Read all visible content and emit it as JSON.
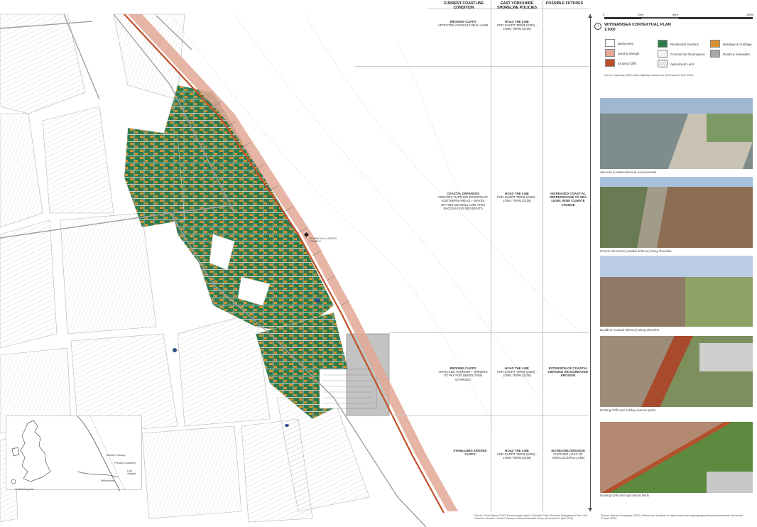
{
  "columns": {
    "current": "CURRENT COASTLINE CONDITION",
    "policies": "EAST YORKSHIRE SHORELINE POLICIES",
    "futures": "POSSIBLE FUTURES"
  },
  "rows": [
    {
      "condition_title": "ERODING CLIFFS",
      "condition_text": "AFFECTED AGRICULTURAL LAND",
      "policy_title": "HOLD THE LINE",
      "policy_text": "FOR SHORT TERM (2025) - LONG TERM (2105)",
      "future_title": "",
      "future_text": ""
    },
    {
      "condition_title": "COASTAL DEFENCES",
      "condition_text": "CREATES FURTHER EROSION AT SOUTHERN AREAS + WAVES HITTING SEAWALL CRE-ATES SHOCKS FOR RESIDENTS",
      "policy_title": "HOLD THE LINE",
      "policy_text": "FOR SHORT TERM (2025) - LONG TERM (2105)",
      "future_title": "INCREASED COAST-AL DEFENCES DUE TO SEA LEVEL RISE/ CLIMATE CHANGE",
      "future_text": ""
    },
    {
      "condition_title": "ERODING CLIFFS",
      "condition_text": "AFFECTED TOURISM + OWNERS TO PAY FOR DEMOLITION CHARGES",
      "policy_title": "HOLD THE LINE",
      "policy_text": "FOR SHORT TERM (2025) - LONG TERM (2105)",
      "future_title": "EXTENSION OF COASTAL DEFENCE OR INCREASED EROSION",
      "future_text": ""
    },
    {
      "condition_title": "STABILIZING ERODED CLIFFS",
      "condition_text": "",
      "policy_title": "HOLD THE LINE",
      "policy_text": "FOR SHORT TERM (2025) - LONG TERM (2105)",
      "future_title": "INCREASED EROSION",
      "future_text": "FURTHER LOSS OF AGRICULTURAL LAND"
    }
  ],
  "map_label": "KILNWICK ALL SAINTS CHURCH",
  "plan": {
    "title": "WITHERNSEA CONTEXTUAL PLAN",
    "scale": "1:5000",
    "scalebar": [
      "0",
      "25m",
      "50m",
      "100m"
    ],
    "legend": [
      {
        "label": "Bathymetry",
        "color": "#ffffff"
      },
      {
        "label": "Sand & Shingle",
        "color": "#e3a897"
      },
      {
        "label": "Eroding Cliffs",
        "color": "#c0502a"
      },
      {
        "label": "Residential Gardens",
        "color": "#2f7a4a"
      },
      {
        "label": "Commercial Greenspace",
        "color": "#f4f4f4"
      },
      {
        "label": "Agricultural Land",
        "color": "#f7f7f4"
      },
      {
        "label": "Buildings & Curtilage",
        "color": "#d9902f"
      },
      {
        "label": "Roads & Sidewalks",
        "color": "#a8a8a8"
      }
    ],
    "source": "Source: Digimaps (2020) https://digimap.edina.ac.uk/ (Accessed 21 April 2020)"
  },
  "photos": [
    {
      "caption": "Sea wall (coastal defence) & promenade",
      "kind": "seawall"
    },
    {
      "caption": "Groyne structures (coastal defence) along shoreline",
      "kind": "groynes"
    },
    {
      "caption": "Boulders (coastal defence) along shoreline",
      "kind": "boulders"
    },
    {
      "caption": "Eroding Cliffs and holiday caravan parks",
      "kind": "caravans"
    },
    {
      "caption": "Eroding Cliffs and Agricultural fields",
      "kind": "fields"
    }
  ],
  "inset": {
    "labels": [
      "United Kingdom",
      "Humber Estuary",
      "Withernsea",
      "Lost villages",
      "Present Coastline"
    ]
  },
  "sources": {
    "left": "Source: Scott Wilson (2010) Flamborough Head to Gibraltar Point Shoreline Management Plan. Hull: Yorkshire Humber, Humber Estuary Coastal Authorities Group (Accessed 21 April 2020)",
    "right": "Source: Internet Geography (2020). Withernsea. Available at: https://www.internetgeography.net/topics/withernsea/ (Accessed 21 April 2020)"
  },
  "colors": {
    "residential": "#2f7a4a",
    "buildings": "#d9902f",
    "sand": "#e3a897",
    "cliff": "#c0502a",
    "roads": "#a8a8a8"
  }
}
